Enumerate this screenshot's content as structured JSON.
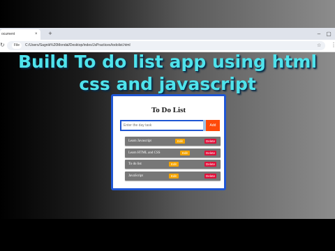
{
  "browser": {
    "tab_title": "ocument",
    "tab_close": "×",
    "new_tab": "+",
    "url": "C:/Users/Sagnik%20Mondal/Desktop/index/JsPractices/todolist.html",
    "file_chip": "File"
  },
  "headline": {
    "line1": "Build To do list app using html",
    "line2": "css and javascript",
    "color": "#4fe3ec"
  },
  "app": {
    "title": "To Do List",
    "input_placeholder": "Enter the day task",
    "add_label": "Add",
    "tasks": [
      {
        "text": "Learn Javascript",
        "edit": "Edit",
        "delete": "Delete"
      },
      {
        "text": "Learn HTML and CSS",
        "edit": "Edit",
        "delete": "Delete"
      },
      {
        "text": "To do list",
        "edit": "Edit",
        "delete": "Delete"
      },
      {
        "text": "JavaScript",
        "edit": "Edit",
        "delete": "Delete"
      }
    ],
    "accent": "#1f56d4",
    "add_color": "#ff4a0a",
    "edit_color": "#f5a400",
    "delete_color": "#e0103a"
  }
}
